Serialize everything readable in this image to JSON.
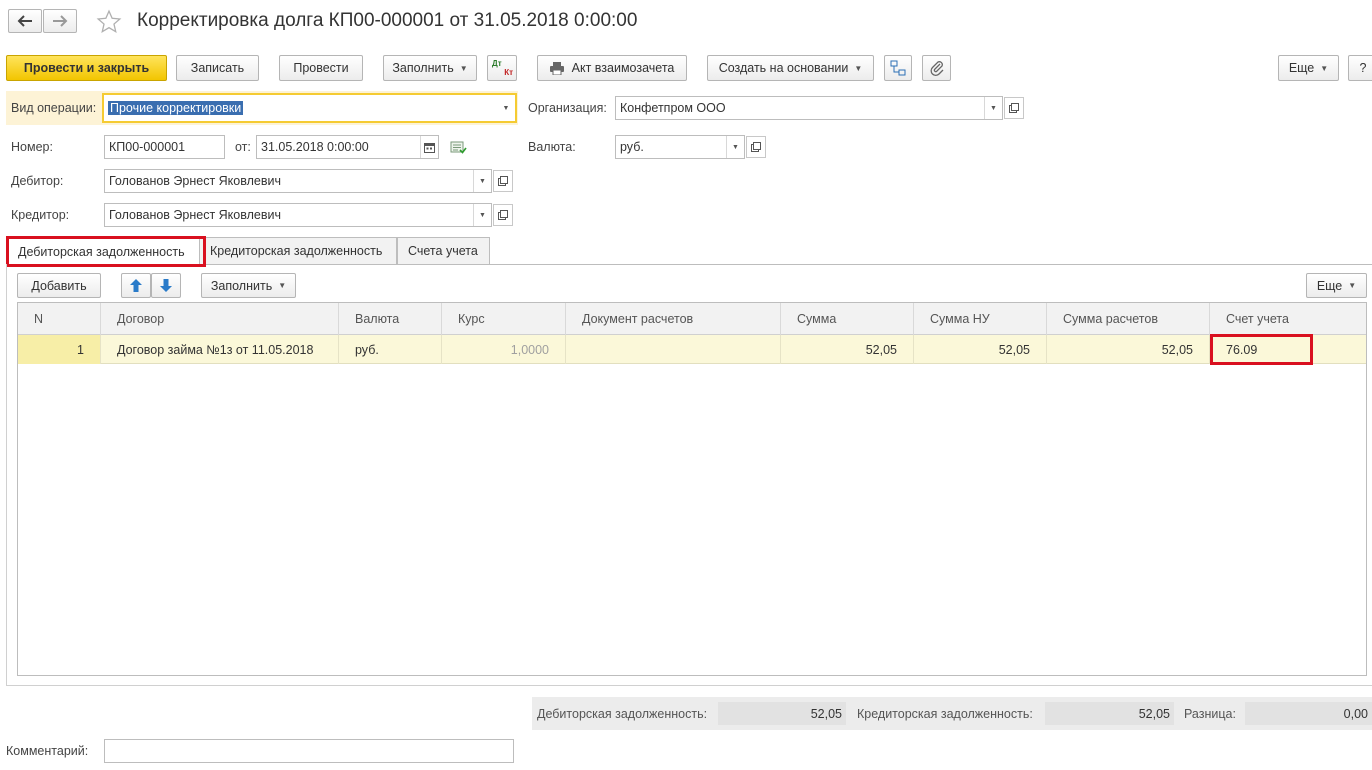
{
  "window": {
    "title": "Корректировка долга КП00-000001 от 31.05.2018 0:00:00",
    "nav_back_icon": "arrow-left-icon",
    "nav_forward_icon": "arrow-right-icon",
    "favorite_icon": "star-icon"
  },
  "toolbar": {
    "post_and_close": "Провести и закрыть",
    "save": "Записать",
    "post": "Провести",
    "fill": "Заполнить",
    "dt_kt_icon_top": "Дт",
    "dt_kt_icon_bottom": "Кт",
    "offset_act": "Акт взаимозачета",
    "create_based_on": "Создать на основании",
    "more": "Еще",
    "help": "?"
  },
  "form": {
    "operation_type_label": "Вид операции:",
    "operation_type_value": "Прочие корректировки",
    "organization_label": "Организация:",
    "organization_value": "Конфетпром ООО",
    "number_label": "Номер:",
    "number_value": "КП00-000001",
    "date_label": "от:",
    "date_value": "31.05.2018  0:00:00",
    "currency_label": "Валюта:",
    "currency_value": "руб.",
    "debtor_label": "Дебитор:",
    "debtor_value": "Голованов Эрнест Яковлевич",
    "creditor_label": "Кредитор:",
    "creditor_value": "Голованов Эрнест Яковлевич"
  },
  "tabs": [
    {
      "label": "Дебиторская задолженность",
      "active": true
    },
    {
      "label": "Кредиторская задолженность",
      "active": false
    },
    {
      "label": "Счета учета",
      "active": false
    }
  ],
  "table_toolbar": {
    "add": "Добавить",
    "fill": "Заполнить",
    "more": "Еще"
  },
  "table": {
    "columns": [
      "N",
      "Договор",
      "Валюта",
      "Курс",
      "Документ расчетов",
      "Сумма",
      "Сумма НУ",
      "Сумма расчетов",
      "Счет учета"
    ],
    "rows": [
      {
        "n": "1",
        "contract": "Договор займа №1з от 11.05.2018",
        "currency": "руб.",
        "rate": "1,0000",
        "doc": "",
        "sum": "52,05",
        "sum_nu": "52,05",
        "sum_settle": "52,05",
        "account": "76.09"
      }
    ]
  },
  "totals": {
    "debit_label": "Дебиторская задолженность:",
    "debit_value": "52,05",
    "credit_label": "Кредиторская задолженность:",
    "credit_value": "52,05",
    "diff_label": "Разница:",
    "diff_value": "0,00"
  },
  "comment": {
    "label": "Комментарий:",
    "value": ""
  },
  "colors": {
    "accent_yellow": "#f2c500",
    "highlight_red": "#d9101f",
    "row_selected": "#fbf8d9"
  }
}
